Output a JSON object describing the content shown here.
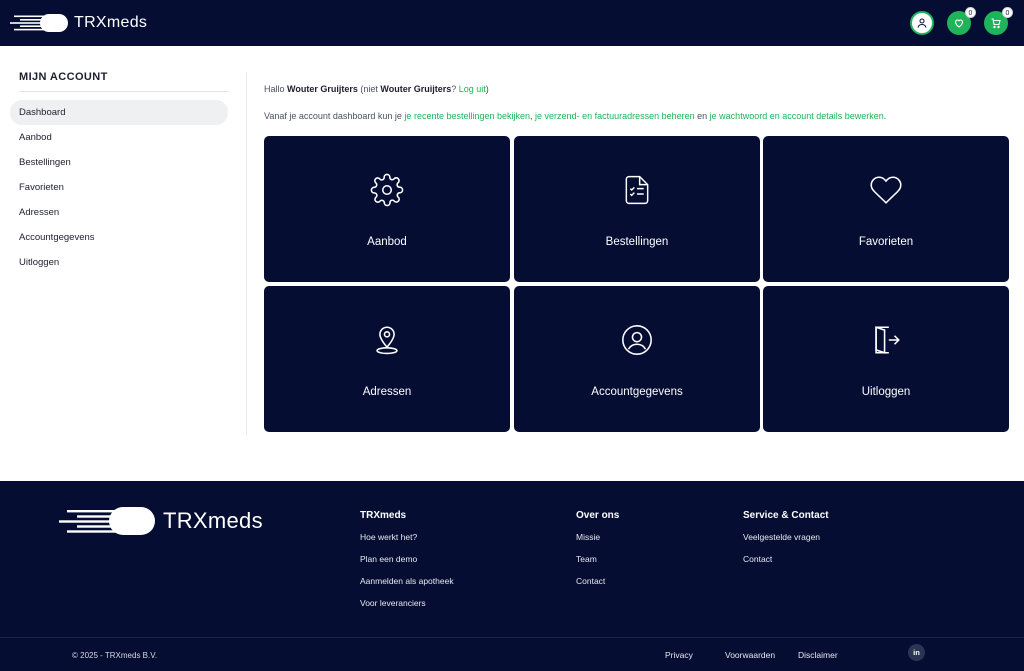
{
  "header": {
    "brand": "TRXmeds",
    "favorites_count": "0",
    "cart_count": "0",
    "icons": {
      "account": "user-icon",
      "favorites": "heart-icon",
      "cart": "cart-icon"
    }
  },
  "sidebar": {
    "title": "MIJN ACCOUNT",
    "items": [
      {
        "label": "Dashboard",
        "active": true
      },
      {
        "label": "Aanbod"
      },
      {
        "label": "Bestellingen"
      },
      {
        "label": "Favorieten"
      },
      {
        "label": "Adressen"
      },
      {
        "label": "Accountgegevens"
      },
      {
        "label": "Uitloggen"
      }
    ]
  },
  "content": {
    "greeting": {
      "prefix": "Hallo ",
      "name": "Wouter Gruijters",
      "middle": " (niet ",
      "name2": "Wouter Gruijters",
      "question": "? ",
      "logout_link": "Log uit",
      "suffix": ")"
    },
    "intro": {
      "part1": "Vanaf je account dashboard kun je ",
      "link1": "je recente bestellingen bekijken",
      "part2": ", ",
      "link2": "je verzend- en factuuradressen beheren",
      "part3": " en ",
      "link3": "je wachtwoord en account details bewerken",
      "part4": "."
    },
    "cards": [
      {
        "label": "Aanbod",
        "icon": "gear-icon"
      },
      {
        "label": "Bestellingen",
        "icon": "document-list-icon"
      },
      {
        "label": "Favorieten",
        "icon": "heart-icon"
      },
      {
        "label": "Adressen",
        "icon": "map-pin-icon"
      },
      {
        "label": "Accountgegevens",
        "icon": "user-circle-icon"
      },
      {
        "label": "Uitloggen",
        "icon": "logout-icon"
      }
    ]
  },
  "footer": {
    "brand": "TRXmeds",
    "columns": [
      {
        "title": "TRXmeds",
        "links": [
          "Hoe werkt het?",
          "Plan een demo",
          "Aanmelden als apotheek",
          "Voor leveranciers"
        ]
      },
      {
        "title": "Over ons",
        "links": [
          "Missie",
          "Team",
          "Contact"
        ]
      },
      {
        "title": "Service & Contact",
        "links": [
          "Veelgestelde vragen",
          "Contact"
        ]
      }
    ],
    "copyright": "© 2025 - TRXmeds B.V.",
    "bottom_links": [
      "Privacy",
      "Voorwaarden",
      "Disclaimer"
    ],
    "social": "in"
  },
  "colors": {
    "navy": "#050d33",
    "accent": "#1fb35a"
  }
}
